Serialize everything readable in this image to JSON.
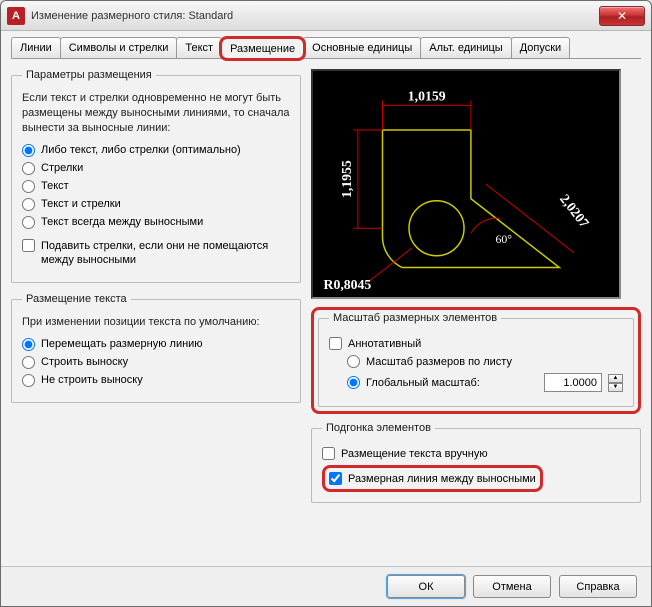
{
  "window": {
    "app_icon_letter": "A",
    "title": "Изменение размерного стиля: Standard"
  },
  "tabs": [
    "Линии",
    "Символы и стрелки",
    "Текст",
    "Размещение",
    "Основные единицы",
    "Альт. единицы",
    "Допуски"
  ],
  "active_tab_index": 3,
  "fit": {
    "group_title": "Параметры размещения",
    "description": "Если текст и стрелки одновременно не могут быть размещены между выносными линиями, то сначала вынести за выносные линии:",
    "options": [
      "Либо текст, либо стрелки (оптимально)",
      "Стрелки",
      "Текст",
      "Текст и стрелки",
      "Текст всегда между выносными"
    ],
    "selected_option": 0,
    "suppress_label": "Подавить стрелки, если они не помещаются между выносными",
    "suppress_checked": false
  },
  "text_placement": {
    "group_title": "Размещение текста",
    "description": "При изменении позиции текста по умолчанию:",
    "options": [
      "Перемещать размерную линию",
      "Строить выноску",
      "Не строить выноску"
    ],
    "selected_option": 0
  },
  "preview": {
    "dim_top": "1,0159",
    "dim_left": "1,1955",
    "dim_right": "2,0207",
    "dim_angle": "60°",
    "dim_radius": "R0,8045"
  },
  "scale": {
    "group_title": "Масштаб размерных элементов",
    "annotative_label": "Аннотативный",
    "annotative_checked": false,
    "options": [
      "Масштаб размеров по листу",
      "Глобальный масштаб:"
    ],
    "selected_option": 1,
    "global_value": "1.0000"
  },
  "fine": {
    "group_title": "Подгонка элементов",
    "manual_label": "Размещение текста вручную",
    "manual_checked": false,
    "dimline_label": "Размерная линия между выносными",
    "dimline_checked": true
  },
  "buttons": {
    "ok": "ОК",
    "cancel": "Отмена",
    "help": "Справка"
  }
}
